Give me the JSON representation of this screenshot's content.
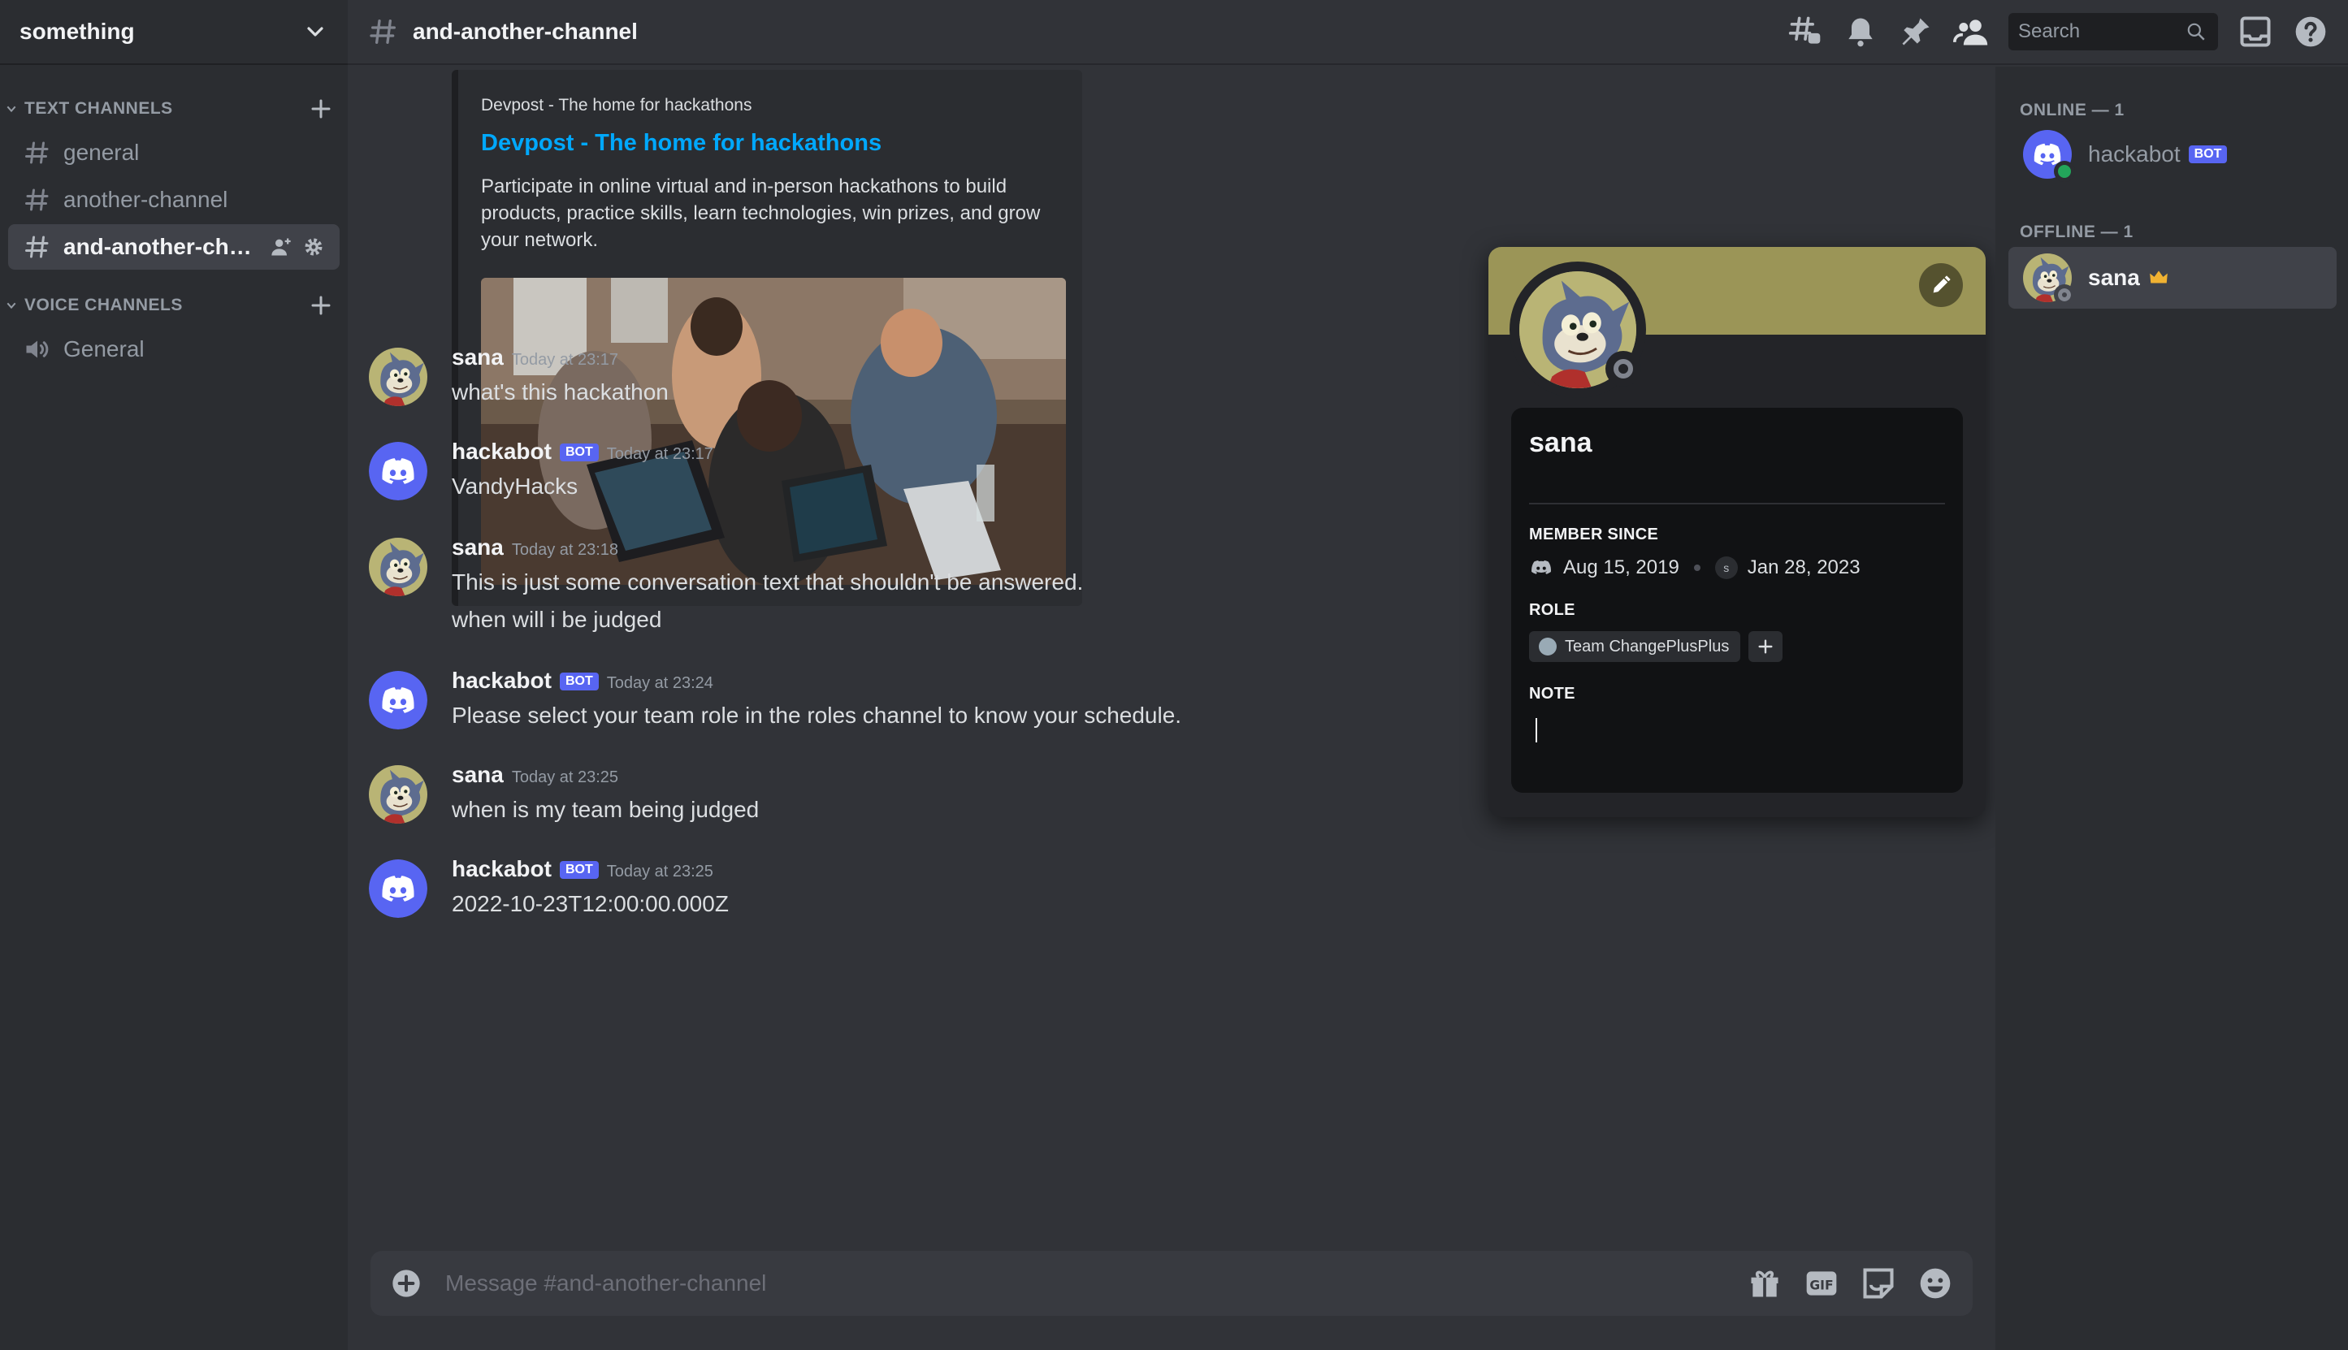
{
  "server": {
    "name": "something"
  },
  "sidebar": {
    "text_category": "TEXT CHANNELS",
    "voice_category": "VOICE CHANNELS",
    "text_channels": [
      {
        "name": "general"
      },
      {
        "name": "another-channel"
      },
      {
        "name": "and-another-chan..."
      }
    ],
    "voice_channels": [
      {
        "name": "General"
      }
    ]
  },
  "topbar": {
    "channel_name": "and-another-channel",
    "search_placeholder": "Search"
  },
  "embed": {
    "provider": "Devpost - The home for hackathons",
    "title": "Devpost - The home for hackathons",
    "description": "Participate in online virtual and in-person hackathons to build products, practice skills, learn technologies, win prizes, and grow your network."
  },
  "messages": [
    {
      "author": "sana",
      "bot": false,
      "timestamp": "Today at 23:17",
      "lines": [
        "what's this hackathon"
      ]
    },
    {
      "author": "hackabot",
      "bot": true,
      "bot_label": "BOT",
      "timestamp": "Today at 23:17",
      "lines": [
        "VandyHacks"
      ]
    },
    {
      "author": "sana",
      "bot": false,
      "timestamp": "Today at 23:18",
      "lines": [
        "This is just some conversation text that shouldn't be answered.",
        "when will i be judged"
      ]
    },
    {
      "author": "hackabot",
      "bot": true,
      "bot_label": "BOT",
      "timestamp": "Today at 23:24",
      "lines": [
        "Please select your team role in the roles channel to know your schedule."
      ]
    },
    {
      "author": "sana",
      "bot": false,
      "timestamp": "Today at 23:25",
      "lines": [
        "when is my team being judged"
      ]
    },
    {
      "author": "hackabot",
      "bot": true,
      "bot_label": "BOT",
      "timestamp": "Today at 23:25",
      "lines": [
        "2022-10-23T12:00:00.000Z"
      ]
    }
  ],
  "composer": {
    "placeholder": "Message #and-another-channel"
  },
  "profile": {
    "name": "sana",
    "member_since_label": "MEMBER SINCE",
    "discord_since": "Aug 15, 2019",
    "server_icon_letter": "s",
    "server_since": "Jan 28, 2023",
    "role_label": "ROLE",
    "role_name": "Team ChangePlusPlus",
    "note_label": "NOTE",
    "banner_color": "#9b9557"
  },
  "members": {
    "online_header": "ONLINE — 1",
    "offline_header": "OFFLINE — 1",
    "online": [
      {
        "name": "hackabot",
        "bot_label": "BOT",
        "status": "online"
      }
    ],
    "offline": [
      {
        "name": "sana",
        "status": "offline",
        "owner": true
      }
    ]
  },
  "colors": {
    "blurple": "#5865f2",
    "link": "#00a8fc",
    "online": "#23a55a",
    "offline": "#80848e",
    "crown": "#f0b232"
  }
}
